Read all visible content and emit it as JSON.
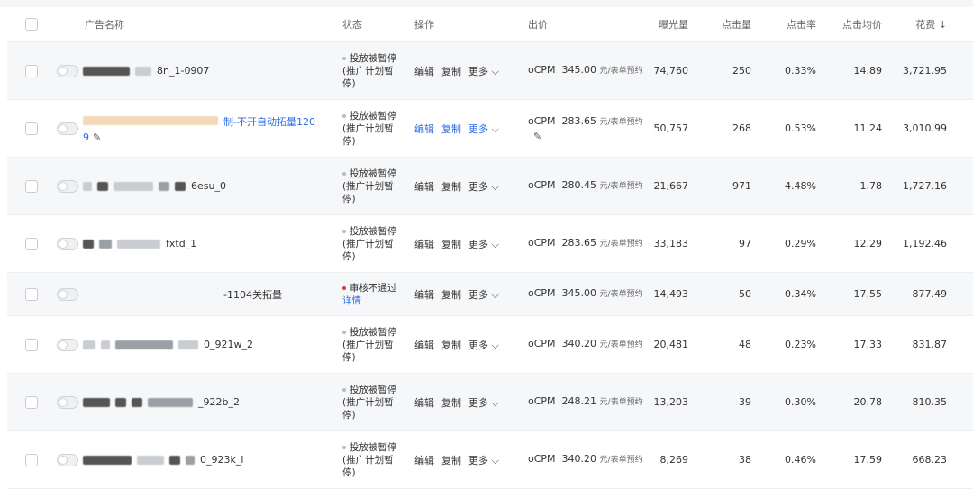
{
  "header": {
    "name": "广告名称",
    "status": "状态",
    "ops": "操作",
    "bid": "出价",
    "impressions": "曝光量",
    "clicks": "点击量",
    "ctr": "点击率",
    "cpc": "点击均价",
    "cost": "花费 ↓"
  },
  "rows": [
    {
      "name": "8n_1-0907",
      "status1": "投放被暂停",
      "status2": "(推广计划暂",
      "status3": "停)",
      "edit": "编辑",
      "copy": "复制",
      "more": "更多 ⌵",
      "bid_type": "oCPM",
      "bid": "345.00",
      "bid_unit": "元/表单预约",
      "imp": "74,760",
      "clk": "250",
      "ctr": "0.33%",
      "cpc": "14.89",
      "cost": "3,721.95"
    },
    {
      "name": "制-不开自动拓量120",
      "name2": "9",
      "status1": "投放被暂停",
      "status2": "(推广计划暂",
      "status3": "停)",
      "edit": "编辑",
      "copy": "复制",
      "more": "更多 ⌵",
      "bid_type": "oCPM",
      "bid": "283.65",
      "bid_unit": "元/表单预约",
      "imp": "50,757",
      "clk": "268",
      "ctr": "0.53%",
      "cpc": "11.24",
      "cost": "3,010.99"
    },
    {
      "name": "6esu_0",
      "status1": "投放被暂停",
      "status2": "(推广计划暂",
      "status3": "停)",
      "edit": "编辑",
      "copy": "复制",
      "more": "更多 ⌵",
      "bid_type": "oCPM",
      "bid": "280.45",
      "bid_unit": "元/表单预约",
      "imp": "21,667",
      "clk": "971",
      "ctr": "4.48%",
      "cpc": "1.78",
      "cost": "1,727.16"
    },
    {
      "name": "fxtd_1",
      "status1": "投放被暂停",
      "status2": "(推广计划暂",
      "status3": "停)",
      "edit": "编辑",
      "copy": "复制",
      "more": "更多 ⌵",
      "bid_type": "oCPM",
      "bid": "283.65",
      "bid_unit": "元/表单预约",
      "imp": "33,183",
      "clk": "97",
      "ctr": "0.29%",
      "cpc": "12.29",
      "cost": "1,192.46"
    },
    {
      "name": "-1104关拓量",
      "status1": "审核不通过",
      "status_link": "详情",
      "edit": "编辑",
      "copy": "复制",
      "more": "更多 ⌵",
      "bid_type": "oCPM",
      "bid": "345.00",
      "bid_unit": "元/表单预约",
      "imp": "14,493",
      "clk": "50",
      "ctr": "0.34%",
      "cpc": "17.55",
      "cost": "877.49"
    },
    {
      "name": "0_921w_2",
      "status1": "投放被暂停",
      "status2": "(推广计划暂",
      "status3": "停)",
      "edit": "编辑",
      "copy": "复制",
      "more": "更多 ⌵",
      "bid_type": "oCPM",
      "bid": "340.20",
      "bid_unit": "元/表单预约",
      "imp": "20,481",
      "clk": "48",
      "ctr": "0.23%",
      "cpc": "17.33",
      "cost": "831.87"
    },
    {
      "name": "_922b_2",
      "status1": "投放被暂停",
      "status2": "(推广计划暂",
      "status3": "停)",
      "edit": "编辑",
      "copy": "复制",
      "more": "更多 ⌵",
      "bid_type": "oCPM",
      "bid": "248.21",
      "bid_unit": "元/表单预约",
      "imp": "13,203",
      "clk": "39",
      "ctr": "0.30%",
      "cpc": "20.78",
      "cost": "810.35"
    },
    {
      "name": "0_923k_l",
      "status1": "投放被暂停",
      "status2": "(推广计划暂",
      "status3": "停)",
      "edit": "编辑",
      "copy": "复制",
      "more": "更多 ⌵",
      "bid_type": "oCPM",
      "bid": "340.20",
      "bid_unit": "元/表单预约",
      "imp": "8,269",
      "clk": "38",
      "ctr": "0.46%",
      "cpc": "17.59",
      "cost": "668.23"
    }
  ]
}
